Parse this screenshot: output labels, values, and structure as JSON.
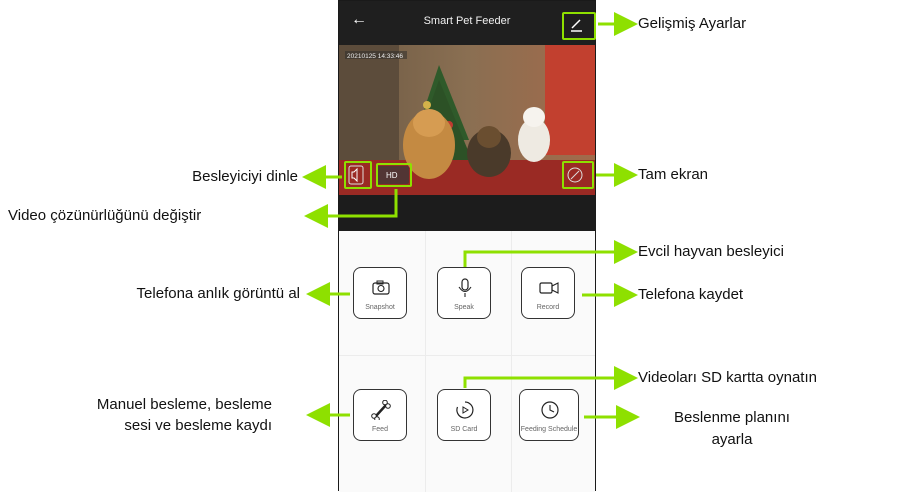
{
  "app": {
    "title": "Smart Pet Feeder",
    "back_icon": "arrow-left-icon",
    "settings_icon": "edit-pencil-icon"
  },
  "video": {
    "overlay_text": "20210125 14:33:46",
    "quality_label": "HD",
    "listen_icon": "speaker-icon",
    "fullscreen_icon": "fullscreen-icon"
  },
  "controls": [
    {
      "label": "Snapshot",
      "icon": "camera-icon"
    },
    {
      "label": "Speak",
      "icon": "microphone-icon"
    },
    {
      "label": "Record",
      "icon": "video-camera-icon"
    },
    {
      "label": "Feed",
      "icon": "bone-icon"
    },
    {
      "label": "SD Card",
      "icon": "play-circle-icon"
    },
    {
      "label": "Feeding Schedule",
      "icon": "clock-icon"
    }
  ],
  "annotations": {
    "settings": "Gelişmiş Ayarlar",
    "listen": "Besleyiciyi dinle",
    "fullscreen": "Tam ekran",
    "resolution": "Video çözünürlüğünü değiştir",
    "speak": "Evcil  hayvan  besleyici",
    "snapshot": "Telefona anlık görüntü al",
    "record": "Telefona kaydet",
    "sdcard": "Videoları SD kartta oynatın",
    "feed_line1": "Manuel  besleme,  besleme",
    "feed_line2": "sesi  ve  besleme  kaydı",
    "schedule_line1": "Beslenme planını",
    "schedule_line2": "ayarla"
  },
  "colors": {
    "accent": "#8ee000",
    "appbar": "#1f1f1f"
  }
}
